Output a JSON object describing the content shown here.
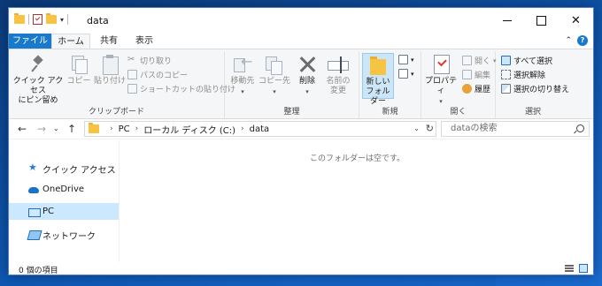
{
  "window": {
    "title": "data"
  },
  "ribbon": {
    "tabs": {
      "file": "ファイル",
      "home": "ホーム",
      "share": "共有",
      "view": "表示"
    },
    "clipboard": {
      "label": "クリップボード",
      "pin_line1": "クイック アクセス",
      "pin_line2": "にピン留め",
      "copy": "コピー",
      "paste": "貼り付け",
      "cut": "切り取り",
      "copy_path": "パスのコピー",
      "paste_shortcut": "ショートカットの貼り付け"
    },
    "organize": {
      "label": "整理",
      "move_to": "移動先",
      "copy_to": "コピー先",
      "delete": "削除",
      "rename_line1": "名前の",
      "rename_line2": "変更"
    },
    "new": {
      "label": "新規",
      "new_folder_line1": "新しい",
      "new_folder_line2": "フォルダー"
    },
    "open": {
      "label": "開く",
      "properties": "プロパティ",
      "open": "開く",
      "edit": "編集",
      "history": "履歴"
    },
    "select": {
      "label": "選択",
      "select_all": "すべて選択",
      "select_none": "選択解除",
      "invert": "選択の切り替え"
    }
  },
  "address": {
    "crumbs": [
      "PC",
      "ローカル ディスク (C:)",
      "data"
    ],
    "search_placeholder": "dataの検索"
  },
  "nav": {
    "items": [
      {
        "label": "クイック アクセス",
        "icon": "star-icon"
      },
      {
        "label": "OneDrive",
        "icon": "cloud-icon"
      },
      {
        "label": "PC",
        "icon": "pc-icon",
        "selected": true
      },
      {
        "label": "ネットワーク",
        "icon": "network-icon"
      }
    ]
  },
  "content": {
    "empty_message": "このフォルダーは空です。"
  },
  "status": {
    "item_count": "0 個の項目"
  },
  "colors": {
    "accent": "#1979ca",
    "selection": "#cce8ff",
    "folder": "#f6c342"
  }
}
